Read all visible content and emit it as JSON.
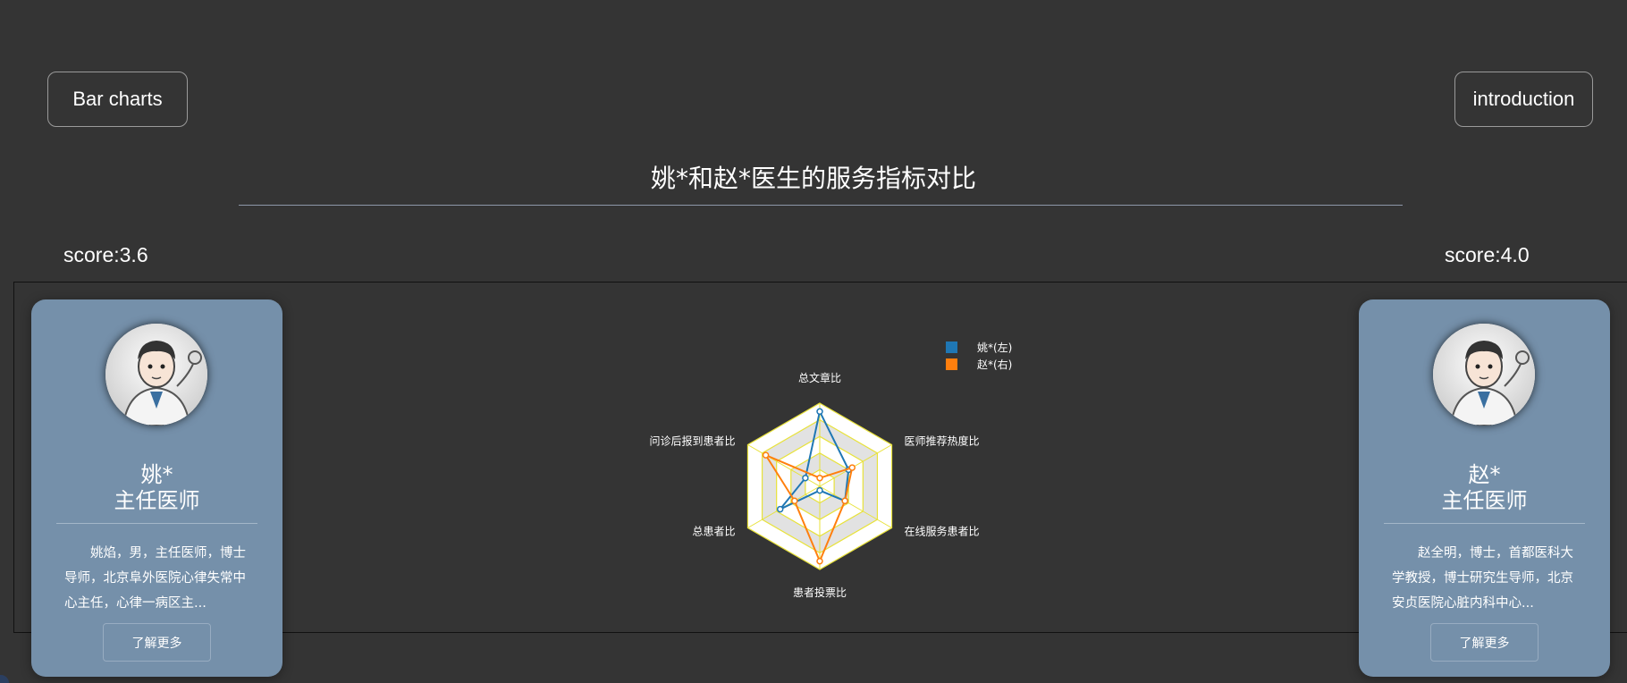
{
  "nav": {
    "bar_charts": "Bar charts",
    "introduction": "introduction"
  },
  "page_title": "姚*和赵*医生的服务指标对比",
  "scores": {
    "left": "score:3.6",
    "right": "score:4.0"
  },
  "doctors": [
    {
      "name": "姚*",
      "title": "主任医师",
      "desc": "姚焰，男，主任医师，博士导师，北京阜外医院心律失常中心主任，心律一病区主...",
      "more": "了解更多"
    },
    {
      "name": "赵*",
      "title": "主任医师",
      "desc": "赵全明，博士，首都医科大学教授，博士研究生导师，北京安贞医院心脏内科中心...",
      "more": "了解更多"
    }
  ],
  "chart_data": {
    "type": "radar",
    "indicators": [
      "总文章比",
      "医师推荐热度比",
      "在线服务患者比",
      "患者投票比",
      "总患者比",
      "问诊后报到患者比"
    ],
    "max": 1,
    "series": [
      {
        "name": "姚*(左)",
        "color": "#1f77b4",
        "values": [
          0.9,
          0.4,
          0.35,
          0.05,
          0.55,
          0.2
        ]
      },
      {
        "name": "赵*(右)",
        "color": "#ff7f0e",
        "values": [
          0.1,
          0.45,
          0.35,
          0.9,
          0.35,
          0.75
        ]
      }
    ],
    "legend_position": "top-right"
  }
}
